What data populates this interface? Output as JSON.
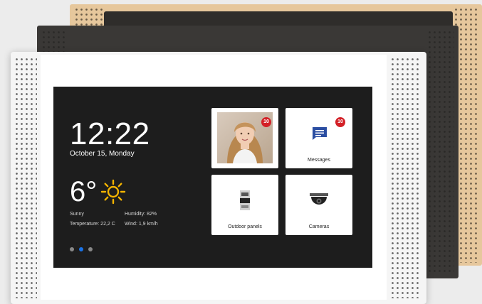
{
  "clock": {
    "time": "12:22",
    "date": "October 15, Monday"
  },
  "weather": {
    "temperature": "6°",
    "condition": "Sunny",
    "humidity": "Humidity: 82%",
    "temperature_detail": "Temperature: 22,2 C",
    "wind": "Wind: 1,9 km/h",
    "icon": "sun-icon"
  },
  "tiles": {
    "video": {
      "badge": "10",
      "icon": "visitor-photo"
    },
    "messages": {
      "label": "Messages",
      "badge": "10",
      "icon": "chat-icon"
    },
    "outdoor": {
      "label": "Outdoor panels",
      "icon": "intercom-panel-icon"
    },
    "cameras": {
      "label": "Cameras",
      "icon": "dome-camera-icon"
    }
  },
  "pager": {
    "count": 3,
    "active_index": 1
  },
  "colors": {
    "accent": "#2b4ea2",
    "badge": "#d32027",
    "screen_bg": "#1d1d1d",
    "active_dot": "#1a73e8"
  }
}
